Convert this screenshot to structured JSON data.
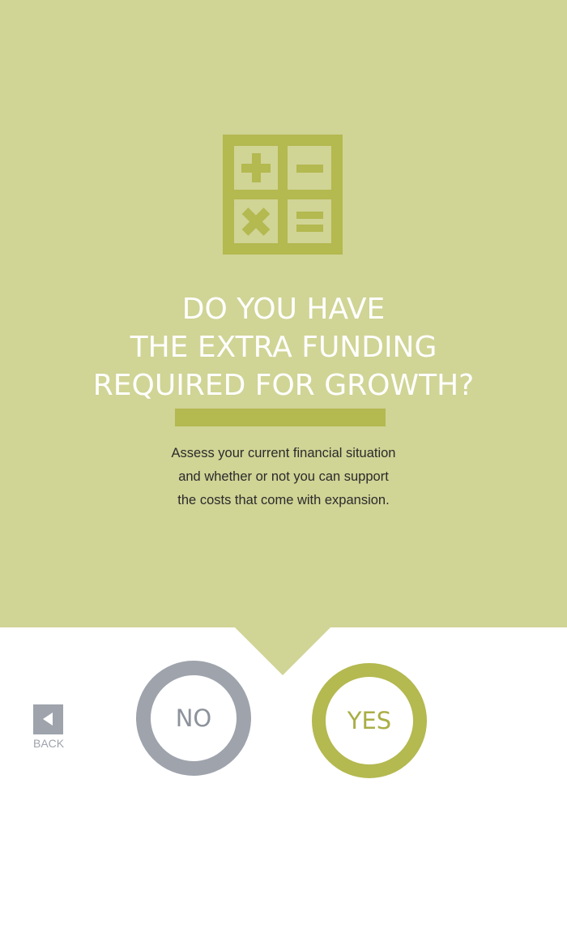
{
  "question": {
    "icon": "calculator-icon",
    "headline_lines": [
      "DO YOU HAVE",
      "THE EXTRA FUNDING",
      "REQUIRED FOR GROWTH?"
    ],
    "description_lines": [
      "Assess your current financial situation",
      "and whether or not you can support",
      "the costs that come with expansion."
    ]
  },
  "actions": {
    "back_label": "BACK",
    "no_label": "NO",
    "yes_label": "YES"
  },
  "colors": {
    "panel": "#d0d495",
    "accent": "#b4b950",
    "gray": "#9ea3ac",
    "headline": "#ffffff"
  }
}
